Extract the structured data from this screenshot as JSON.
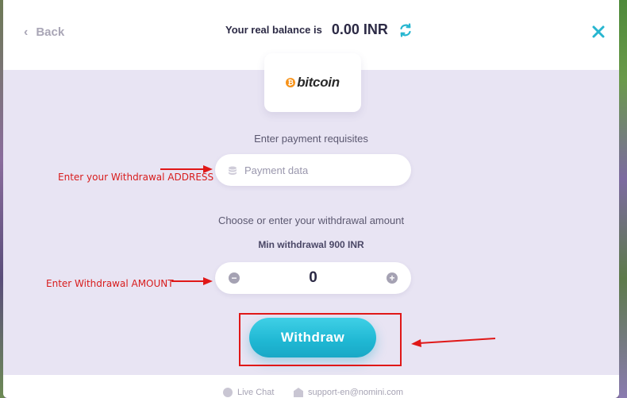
{
  "header": {
    "back_label": "Back",
    "balance_label": "Your real balance is",
    "balance_value": "0.00 INR",
    "icons": [
      "chevron-left-icon",
      "refresh-icon",
      "close-icon"
    ]
  },
  "payment_method": {
    "logo_text": "bitcoin",
    "logo_symbol": "₿"
  },
  "form": {
    "requisites_label": "Enter payment requisites",
    "payment_placeholder": "Payment data",
    "amount_label": "Choose or enter your withdrawal amount",
    "min_label": "Min withdrawal 900 INR",
    "amount_value": "0",
    "minus_symbol": "−",
    "plus_symbol": "+",
    "submit_label": "Withdraw"
  },
  "annotations": {
    "address_note": "Enter your Withdrawal ADDRESS",
    "amount_note": "Enter Withdrawal AMOUNT"
  },
  "footer": {
    "live_chat": "Live Chat",
    "support_email": "support-en@nomini.com"
  },
  "colors": {
    "accent": "#1fb7d3",
    "panel_bg": "#e8e4f3",
    "annotation_red": "#d81c1c",
    "bitcoin_orange": "#f7931a"
  }
}
